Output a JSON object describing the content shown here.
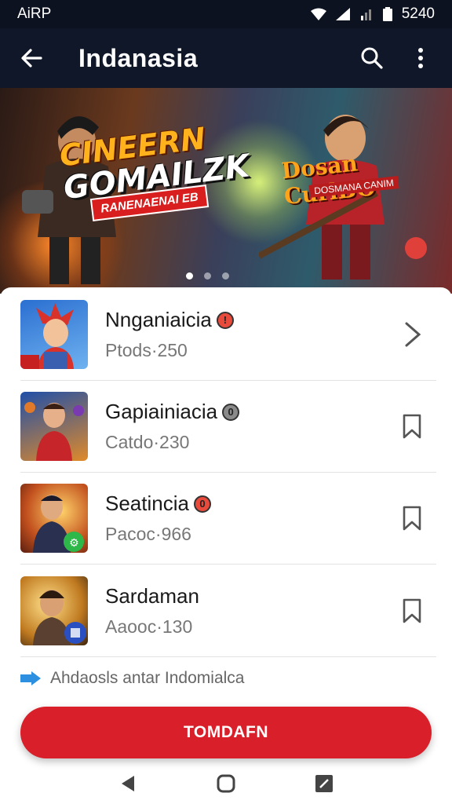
{
  "status_bar": {
    "carrier": "AiRP",
    "time": "5240"
  },
  "app_bar": {
    "title": "Indanasia",
    "back_icon": "arrow-left-icon",
    "search_icon": "search-icon",
    "menu_icon": "more-vert-icon"
  },
  "banner": {
    "title_line1": "CINEERN",
    "title_line2": "GOMAILZK",
    "tag": "RANENAENAI EB",
    "subtitle": "Dosan CurlBO",
    "subtitle_tag": "DOSMANA CANIM",
    "pages": 3,
    "active_page": 1
  },
  "items": [
    {
      "name": "Nnganiaicia",
      "sub": "Ptods·250",
      "badge_color": "#e84a3c",
      "trail_icon": "chevron-right-icon"
    },
    {
      "name": "Gapiainiacia",
      "sub": "Catdo·230",
      "badge_color": "#8a8a8a",
      "trail_icon": "bookmark-icon"
    },
    {
      "name": "Seatincia",
      "sub": "Pacoc·966",
      "badge_color": "#e84a3c",
      "trail_icon": "bookmark-icon"
    },
    {
      "name": "Sardaman",
      "sub": "Aaooc·130",
      "badge_color": "",
      "trail_icon": "bookmark-icon"
    }
  ],
  "footer_note": "Ahdaosls antar Indomialca",
  "cta_label": "TOMDAFN",
  "colors": {
    "accent": "#d81f2a",
    "app_bar": "#0f1729"
  },
  "nav": {
    "back": "nav-back-icon",
    "home": "nav-home-icon",
    "recents": "nav-recents-icon"
  }
}
